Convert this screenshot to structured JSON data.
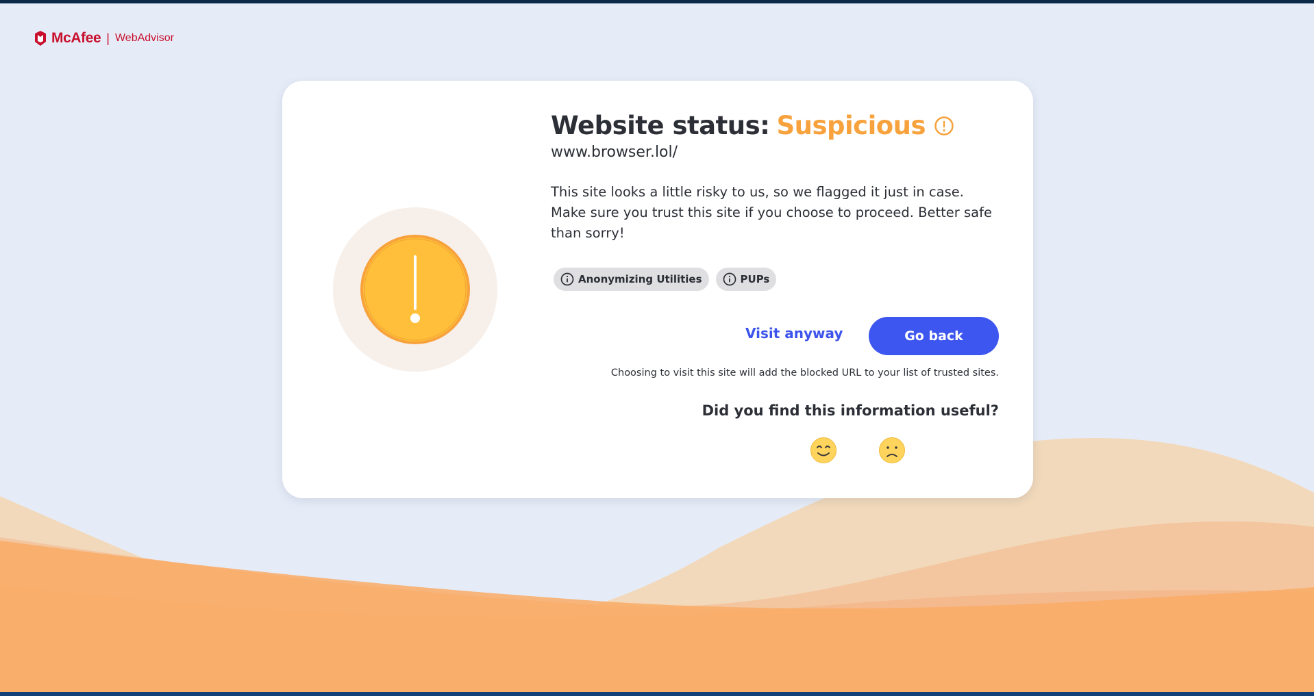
{
  "brand": {
    "name": "McAfee",
    "product": "WebAdvisor",
    "separator": "|",
    "color": "#c8102e"
  },
  "status": {
    "title_prefix": "Website status:",
    "level": "Suspicious",
    "icon": "warning-circle-icon",
    "color": "#f7a23c"
  },
  "site": {
    "url": "www.browser.lol/"
  },
  "description": "This site looks a little risky to us, so we flagged it just in case. Make sure you trust this site if you choose to proceed. Better safe than sorry!",
  "tags": [
    {
      "label": "Anonymizing Utilities",
      "icon": "info-icon"
    },
    {
      "label": "PUPs",
      "icon": "info-icon"
    }
  ],
  "actions": {
    "visit_label": "Visit anyway",
    "back_label": "Go back",
    "accent": "#3d56f0"
  },
  "note": "Choosing to visit this site will add the blocked URL to your list of trusted sites.",
  "feedback": {
    "question": "Did you find this information useful?",
    "options": [
      "smile-face-icon",
      "frown-face-icon"
    ]
  }
}
